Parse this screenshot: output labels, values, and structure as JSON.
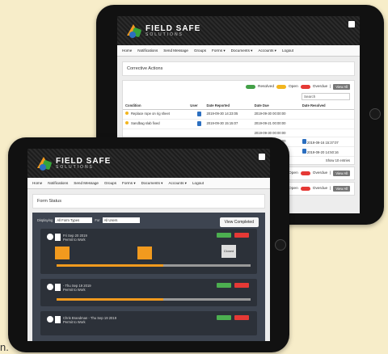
{
  "back": {
    "brand_line1": "FIELD SAFE",
    "brand_line2": "SOLUTIONS",
    "nav": [
      "Home",
      "Notifications",
      "Send Message",
      "Groups",
      "Forms ▾",
      "Documents ▾",
      "Accounts ▾",
      "Logout"
    ],
    "page_title": "Corrective Actions",
    "legend": {
      "resolved": "Resolved",
      "open": "Open",
      "overdue": "Overdue",
      "divider": "|",
      "view_all": "View All"
    },
    "search_placeholder": "Search",
    "columns": [
      "Condition",
      "User",
      "Date Reported",
      "Date Due",
      "Date Resolved"
    ],
    "rows": [
      {
        "condition": "Replace rope on rig sheet",
        "reported": "2019-09-30 14:23:05",
        "due": "2019-09-30 00:00:00",
        "resolved": ""
      },
      {
        "condition": "Sandbag slab fixed",
        "reported": "2019-09-30 15:15:07",
        "due": "2019-09-21 00:00:00",
        "resolved": ""
      },
      {
        "condition": "",
        "reported": "",
        "due": "2019-09-30 00:00:00",
        "resolved": ""
      },
      {
        "condition": "",
        "reported": "",
        "due": "2019-09-03 00:00:00",
        "resolved": "2019-09-16 15:37:07"
      },
      {
        "condition": "",
        "reported": "",
        "due": "2019-09-03 00:00:00",
        "resolved": "2019-09-20 14:50:16"
      }
    ],
    "showing_label": "Show",
    "showing_count": "10",
    "showing_suffix": "entries",
    "extra_rows": [
      {
        "open": "Open",
        "overdue": "Overdue",
        "divider": "|",
        "view_all": "View All"
      },
      {
        "open": "Open",
        "overdue": "Overdue",
        "divider": "|",
        "view_all": "View All"
      }
    ]
  },
  "front": {
    "brand_line1": "FIELD SAFE",
    "brand_line2": "SOLUTIONS",
    "nav": [
      "Home",
      "Notifications",
      "Send Message",
      "Groups",
      "Forms ▾",
      "Documents ▾",
      "Accounts ▾",
      "Logout"
    ],
    "page_title": "Form Status",
    "filter_label": "Displaying",
    "filter_form": "All Form Types",
    "filter_for": "For",
    "filter_user": "All Users",
    "view_completed": "View Completed",
    "cards": [
      {
        "date": "Fri Sep 20 2019",
        "name": "Permit to Work",
        "stages": [
          "",
          "",
          "Closed"
        ],
        "progress": 0.55
      },
      {
        "date": "- Thu Sep 19 2019",
        "name": "Permit to Work",
        "progress": 0.55
      },
      {
        "date": "Chris Brandman - Thu Sep 19 2019",
        "name": "Permit to Work",
        "progress": 0.0
      }
    ]
  },
  "caption": "n."
}
